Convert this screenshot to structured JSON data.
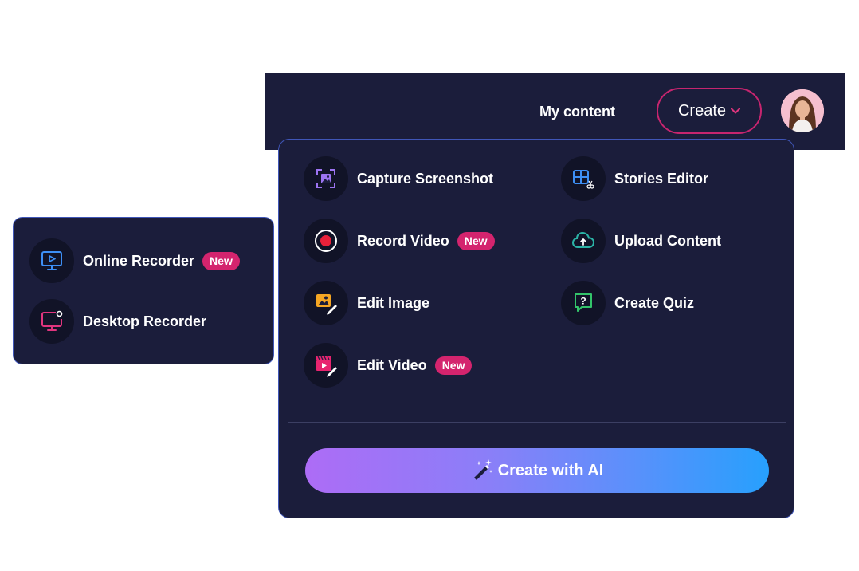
{
  "navbar": {
    "my_content": "My content",
    "create_label": "Create"
  },
  "menu": {
    "items": [
      {
        "label": "Capture Screenshot",
        "icon": "screenshot-icon"
      },
      {
        "label": "Stories Editor",
        "icon": "stories-editor-icon"
      },
      {
        "label": "Record Video",
        "icon": "record-icon",
        "badge": "New"
      },
      {
        "label": "Upload Content",
        "icon": "cloud-upload-icon"
      },
      {
        "label": "Edit Image",
        "icon": "edit-image-icon"
      },
      {
        "label": "Create Quiz",
        "icon": "quiz-icon"
      },
      {
        "label": "Edit Video",
        "icon": "edit-video-icon",
        "badge": "New"
      }
    ],
    "ai_button": "Create with AI"
  },
  "submenu": {
    "items": [
      {
        "label": "Online Recorder",
        "icon": "monitor-play-icon",
        "badge": "New"
      },
      {
        "label": "Desktop Recorder",
        "icon": "desktop-icon"
      }
    ]
  },
  "colors": {
    "background": "#1b1d3b",
    "accent_pink": "#d4246e",
    "border_blue": "#4056b8",
    "ai_gradient_start": "#ad6cf6",
    "ai_gradient_end": "#27a0fd"
  }
}
